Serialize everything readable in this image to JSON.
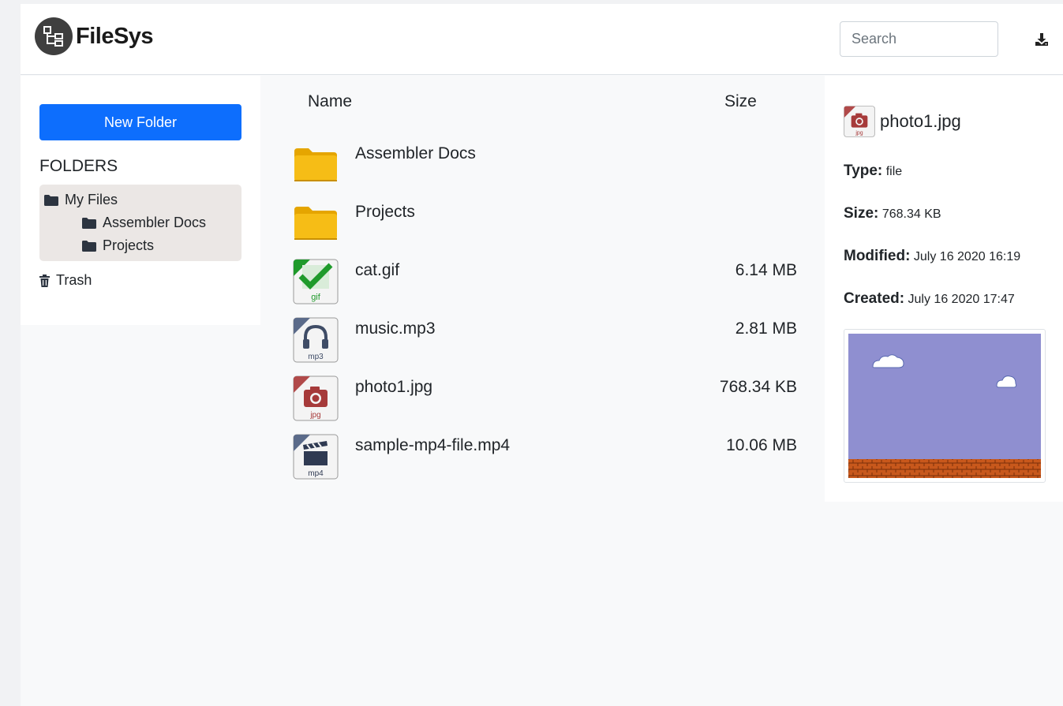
{
  "app": {
    "name": "FileSys"
  },
  "header": {
    "search_placeholder": "Search",
    "download_icon": "download-icon"
  },
  "sidebar": {
    "new_folder_label": "New Folder",
    "folders_heading": "FOLDERS",
    "tree": [
      {
        "label": "My Files",
        "icon": "folder-icon",
        "level": 0
      },
      {
        "label": "Assembler Docs",
        "icon": "folder-icon",
        "level": 1
      },
      {
        "label": "Projects",
        "icon": "folder-icon",
        "level": 1
      }
    ],
    "trash_label": "Trash"
  },
  "file_list": {
    "columns": {
      "name": "Name",
      "size": "Size"
    },
    "rows": [
      {
        "name": "Assembler Docs",
        "size": "",
        "icon": "folder-icon"
      },
      {
        "name": "Projects",
        "size": "",
        "icon": "folder-icon"
      },
      {
        "name": "cat.gif",
        "size": "6.14 MB",
        "icon": "gif-file-icon",
        "ext": "gif"
      },
      {
        "name": "music.mp3",
        "size": "2.81 MB",
        "icon": "mp3-file-icon",
        "ext": "mp3"
      },
      {
        "name": "photo1.jpg",
        "size": "768.34 KB",
        "icon": "jpg-file-icon",
        "ext": "jpg"
      },
      {
        "name": "sample-mp4-file.mp4",
        "size": "10.06 MB",
        "icon": "mp4-file-icon",
        "ext": "mp4"
      }
    ]
  },
  "details": {
    "name": "photo1.jpg",
    "type_label": "Type:",
    "type_value": "file",
    "size_label": "Size:",
    "size_value": "768.34 KB",
    "modified_label": "Modified:",
    "modified_value": "July 16 2020 16:19",
    "created_label": "Created:",
    "created_value": "July 16 2020 17:47"
  },
  "colors": {
    "primary": "#0d6efd",
    "folder": "#f5b700",
    "tree_bg": "#ebe7e5",
    "preview_sky": "#8f8fd0",
    "preview_brick": "#c8581c"
  }
}
